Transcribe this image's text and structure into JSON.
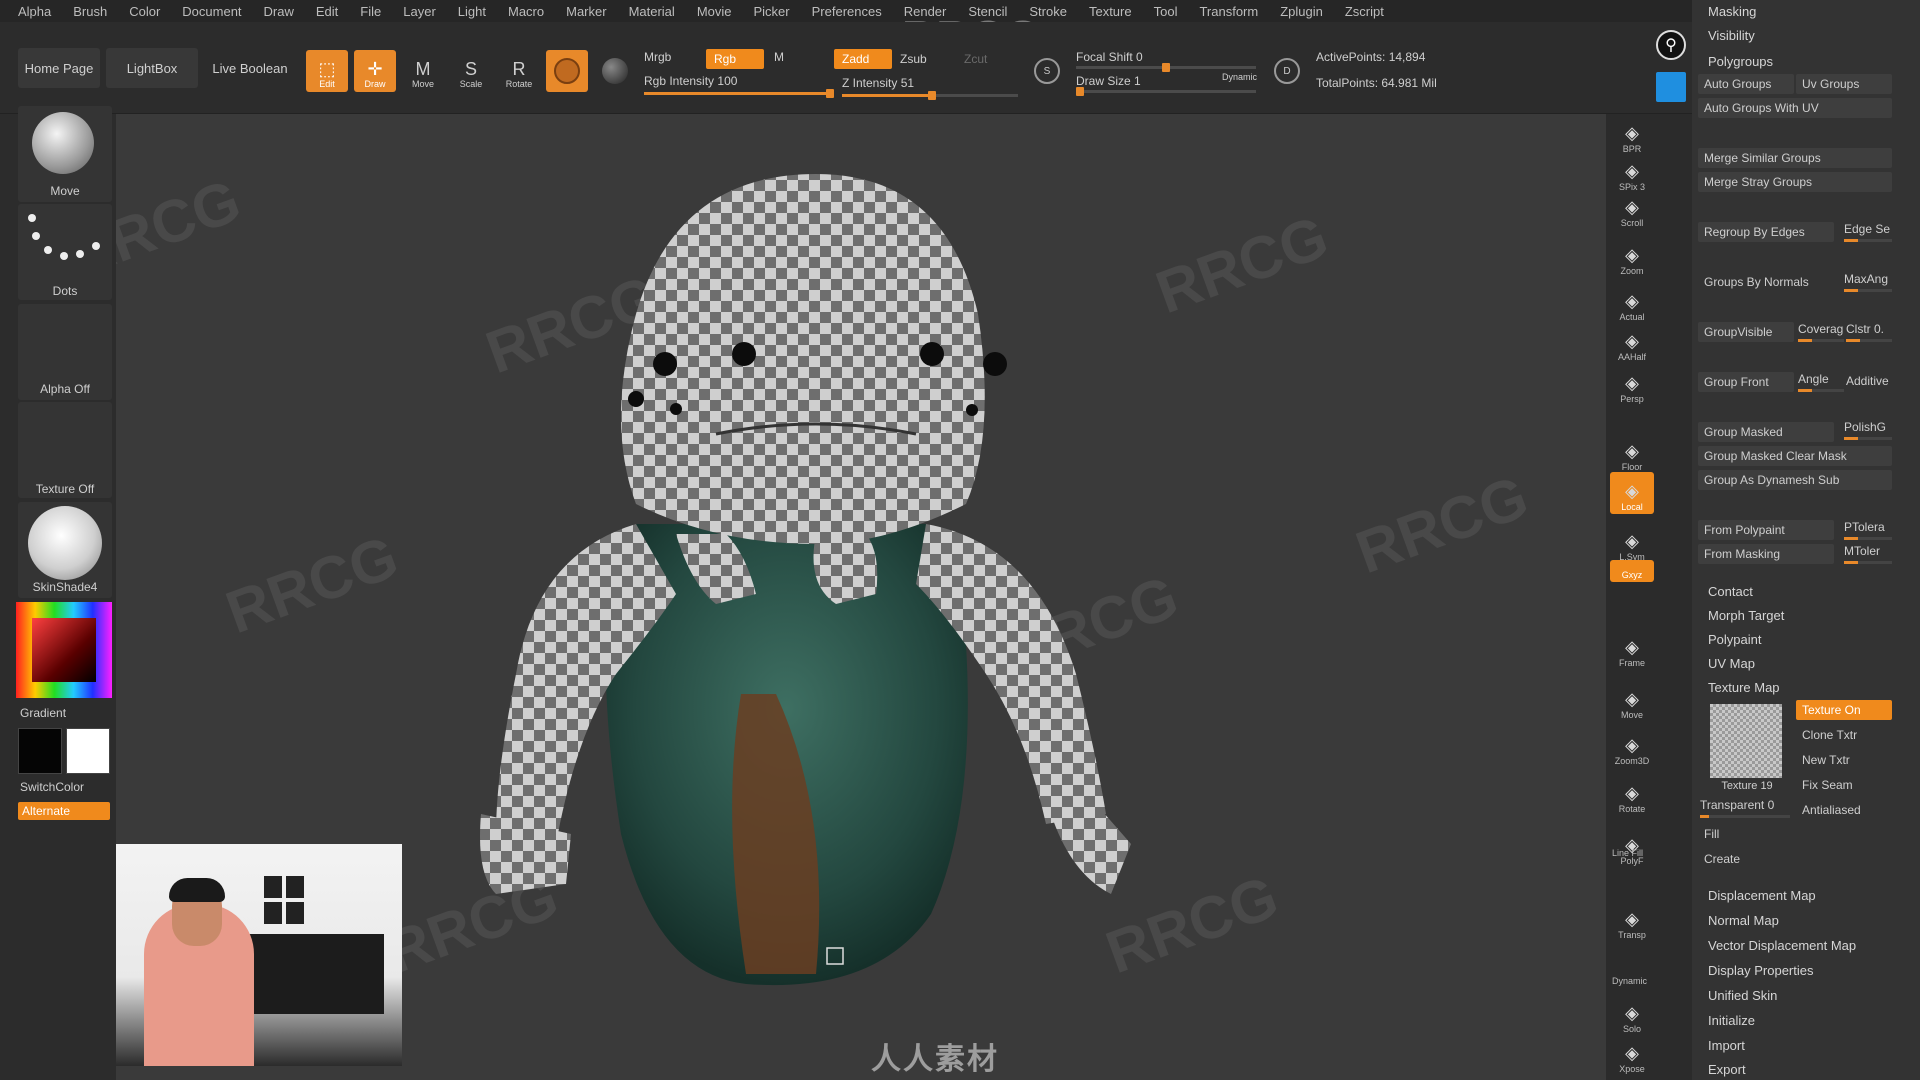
{
  "menu": [
    "Alpha",
    "Brush",
    "Color",
    "Document",
    "Draw",
    "Edit",
    "File",
    "Layer",
    "Light",
    "Macro",
    "Marker",
    "Material",
    "Movie",
    "Picker",
    "Preferences",
    "Render",
    "Stencil",
    "Stroke",
    "Texture",
    "Tool",
    "Transform",
    "Zplugin",
    "Zscript"
  ],
  "watermark": "RRCG",
  "watermark_bottom": "人人素材",
  "toolbar": {
    "home_page": "Home Page",
    "lightbox": "LightBox",
    "live_boolean": "Live Boolean",
    "edit": "Edit",
    "draw": "Draw",
    "move": "Move",
    "scale": "Scale",
    "rotate": "Rotate",
    "mrgb": "Mrgb",
    "rgb": "Rgb",
    "m": "M",
    "zadd": "Zadd",
    "zsub": "Zsub",
    "zcut": "Zcut",
    "rgb_intensity_label": "Rgb Intensity",
    "rgb_intensity_value": "100",
    "rgb_intensity": 1.0,
    "z_intensity_label": "Z Intensity",
    "z_intensity_value": "51",
    "z_intensity": 0.51,
    "focal_shift_label": "Focal Shift",
    "focal_shift_value": "0",
    "draw_size_label": "Draw Size",
    "draw_size_value": "1",
    "dynamic": "Dynamic",
    "active_points": "ActivePoints: 14,894",
    "total_points": "TotalPoints: 64.981 Mil"
  },
  "left_shelf": {
    "brush": "Move",
    "stroke": "Dots",
    "alpha": "Alpha Off",
    "texture": "Texture Off",
    "material": "SkinShade4",
    "gradient": "Gradient",
    "switch_color": "SwitchColor",
    "alternate": "Alternate"
  },
  "right_shelf": [
    {
      "icon": "bpr-icon",
      "label": "BPR"
    },
    {
      "icon": "spix-icon",
      "label": "SPix 3"
    },
    {
      "icon": "scroll-icon",
      "label": "Scroll"
    },
    {
      "icon": "zoom-icon",
      "label": "Zoom"
    },
    {
      "icon": "actual-icon",
      "label": "Actual"
    },
    {
      "icon": "aahalf-icon",
      "label": "AAHalf"
    },
    {
      "icon": "persp-icon",
      "label": "Persp"
    },
    {
      "icon": "floor-icon",
      "label": "Floor"
    },
    {
      "icon": "local-icon",
      "label": "Local"
    },
    {
      "icon": "lsym-icon",
      "label": "L.Sym"
    },
    {
      "icon": "xyz-icon",
      "label": "Gxyz"
    },
    {
      "icon": "frame-icon",
      "label": "Frame"
    },
    {
      "icon": "move-icon",
      "label": "Move"
    },
    {
      "icon": "zoom3d-icon",
      "label": "Zoom3D"
    },
    {
      "icon": "rotate-icon",
      "label": "Rotate"
    },
    {
      "icon": "polyf-icon",
      "label": "PolyF"
    },
    {
      "icon": "transp-icon",
      "label": "Transp"
    },
    {
      "icon": "solo-icon",
      "label": "Solo"
    },
    {
      "icon": "xpose-icon",
      "label": "Xpose"
    }
  ],
  "right_shelf_extra": {
    "line_fill": "Line Fill",
    "dynamic": "Dynamic"
  },
  "right_panel": {
    "masking": "Masking",
    "visibility": "Visibility",
    "polygroups": "Polygroups",
    "auto_groups": "Auto Groups",
    "uv_groups": "Uv Groups",
    "auto_groups_uv": "Auto Groups With UV",
    "merge_similar": "Merge Similar Groups",
    "merge_stray": "Merge Stray Groups",
    "regroup_edges": "Regroup By Edges",
    "edge_se": "Edge Se",
    "groups_normals": "Groups By Normals",
    "maxang": "MaxAng",
    "group_visible": "GroupVisible",
    "coverage": "Coverag",
    "clstr": "Clstr 0.",
    "group_front": "Group Front",
    "angle": "Angle",
    "additive": "Additive",
    "group_masked": "Group Masked",
    "polishg": "PolishG",
    "group_masked_clear": "Group Masked Clear Mask",
    "group_dynamesh": "Group As Dynamesh Sub",
    "from_polypaint": "From Polypaint",
    "ptolera": "PTolera",
    "from_masking": "From Masking",
    "mtolera": "MToler",
    "contact": "Contact",
    "morph_target": "Morph Target",
    "polypaint": "Polypaint",
    "uv_map": "UV Map",
    "texture_map": "Texture Map",
    "texture_on": "Texture On",
    "clone_txtr": "Clone Txtr",
    "new_txtr": "New Txtr",
    "fix_seam": "Fix Seam",
    "texture_thumb": "Texture 19",
    "transparent": "Transparent 0",
    "antialiased": "Antialiased",
    "fill": "Fill",
    "create": "Create",
    "displacement_map": "Displacement Map",
    "normal_map": "Normal Map",
    "vector_displacement": "Vector Displacement Map",
    "display_properties": "Display Properties",
    "unified_skin": "Unified Skin",
    "initialize": "Initialize",
    "import": "Import",
    "export": "Export"
  },
  "colors": {
    "accent": "#f08a1c",
    "panel": "#333333",
    "viewport": "#3a3a3a"
  }
}
